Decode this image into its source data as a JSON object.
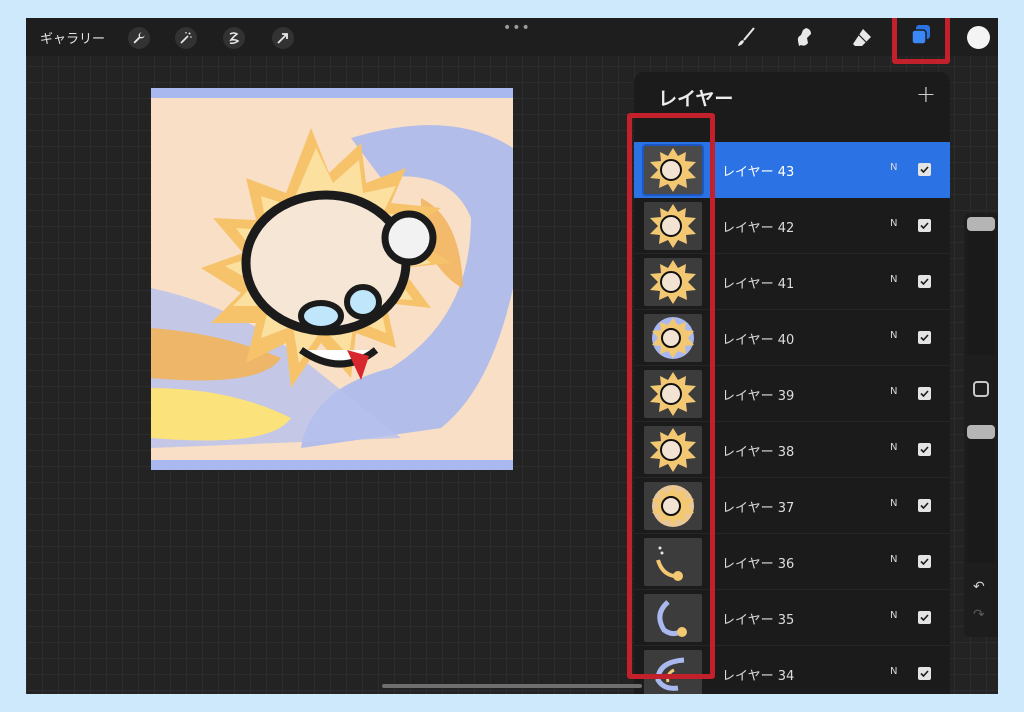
{
  "toolbar": {
    "gallery_label": "ギャラリー",
    "left_tools": [
      "wrench-icon",
      "magic-wand-icon",
      "selection-icon",
      "transform-arrow-icon"
    ],
    "more_glyph": "•••",
    "right_tools": [
      "brush-icon",
      "smudge-icon",
      "eraser-icon",
      "layers-icon"
    ],
    "current_color": "#f4f4f4",
    "accent": "#2b73e4",
    "highlight_color": "#c2202a"
  },
  "layers_panel": {
    "title": "レイヤー",
    "add_label": "+",
    "layers": [
      {
        "name": "レイヤー 43",
        "blend": "N",
        "visible": true,
        "active": true
      },
      {
        "name": "レイヤー 42",
        "blend": "N",
        "visible": true,
        "active": false
      },
      {
        "name": "レイヤー 41",
        "blend": "N",
        "visible": true,
        "active": false
      },
      {
        "name": "レイヤー 40",
        "blend": "N",
        "visible": true,
        "active": false
      },
      {
        "name": "レイヤー 39",
        "blend": "N",
        "visible": true,
        "active": false
      },
      {
        "name": "レイヤー 38",
        "blend": "N",
        "visible": true,
        "active": false
      },
      {
        "name": "レイヤー 37",
        "blend": "N",
        "visible": true,
        "active": false
      },
      {
        "name": "レイヤー 36",
        "blend": "N",
        "visible": true,
        "active": false
      },
      {
        "name": "レイヤー 35",
        "blend": "N",
        "visible": true,
        "active": false
      },
      {
        "name": "レイヤー 34",
        "blend": "N",
        "visible": true,
        "active": false
      }
    ]
  },
  "sidebar": {
    "undo_glyph": "↶",
    "redo_glyph": "↷"
  }
}
